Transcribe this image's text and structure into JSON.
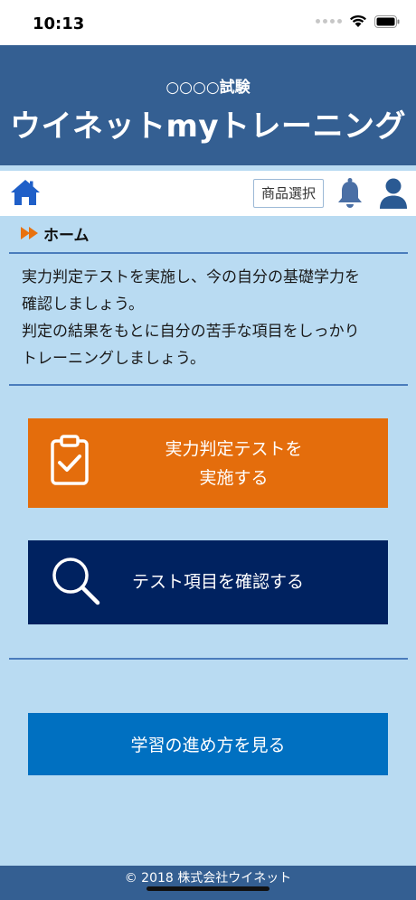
{
  "status_bar": {
    "time": "10:13"
  },
  "header": {
    "exam_name": "○○○○試験",
    "app_title": "ウイネットmyトレーニング"
  },
  "toolbar": {
    "product_select_label": "商品選択",
    "icons": [
      "home-icon",
      "bell-icon",
      "user-icon"
    ]
  },
  "breadcrumb": {
    "label": "ホーム"
  },
  "intro": {
    "line1": "実力判定テストを実施し、今の自分の基礎学力を",
    "line2": "確認しましょう。",
    "line3": "判定の結果をもとに自分の苦手な項目をしっかり",
    "line4": "トレーニングしましょう。"
  },
  "actions": {
    "test": {
      "line1": "実力判定テストを",
      "line2": "実施する",
      "icon": "clipboard-check-icon"
    },
    "items": {
      "label": "テスト項目を確認する",
      "icon": "search-icon"
    },
    "guide": {
      "label": "学習の進め方を見る"
    }
  },
  "footer": {
    "copyright": "© 2018 株式会社ウイネット"
  },
  "colors": {
    "header": "#345f92",
    "background": "#b9dbf2",
    "test_button": "#e46d0c",
    "items_button": "#002260",
    "guide_button": "#0070c1",
    "accent_icon": "#1f5fc8",
    "breadcrumb_arrow": "#e8710e"
  }
}
